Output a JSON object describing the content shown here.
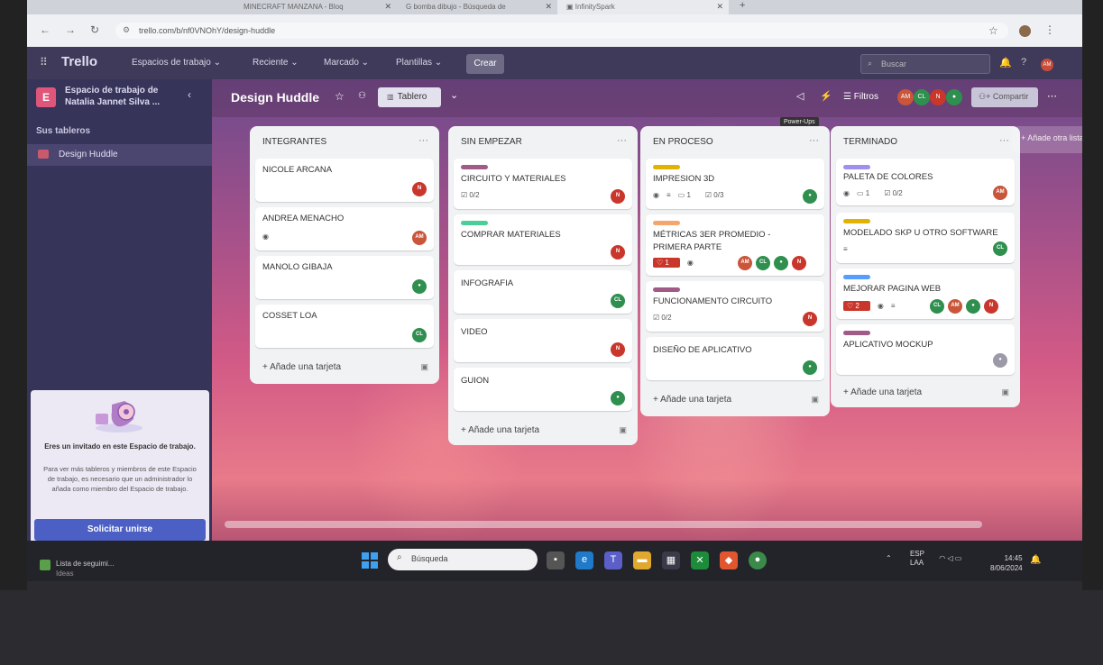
{
  "browser": {
    "tabs": [
      {
        "title": "MINECRAFT MANZANA - Bloq"
      },
      {
        "title": "bomba dibujo - Búsqueda de"
      },
      {
        "title": "InfinitySpark"
      }
    ],
    "url": "trello.com/b/nf0VNOhY/design-huddle"
  },
  "header": {
    "logo": "Trello",
    "nav": [
      "Espacios de trabajo",
      "Reciente",
      "Marcado",
      "Plantillas"
    ],
    "create": "Crear",
    "search_placeholder": "Buscar",
    "avatar": "AM"
  },
  "sidebar": {
    "workspace_initial": "E",
    "workspace_name": "Espacio de trabajo de Natalia Jannet Silva ...",
    "boards_heading": "Sus tableros",
    "boards": [
      "Design Huddle"
    ],
    "invite": {
      "title": "Eres un invitado en este Espacio de trabajo.",
      "body": "Para ver más tableros y miembros de este Espacio de trabajo, es necesario que un administrador lo añada como miembro del Espacio de trabajo.",
      "button": "Solicitar unirse"
    }
  },
  "board": {
    "title": "Design Huddle",
    "view": "Tablero",
    "filters": "Filtros",
    "powerups_tooltip": "Power-Ups",
    "members": [
      "AM",
      "CL",
      "N"
    ],
    "share": "Compartir",
    "add_list": "Añade otra lista",
    "add_card": "Añade una tarjeta",
    "lists": [
      {
        "name": "INTEGRANTES",
        "cards": [
          {
            "title": "NICOLE ARCANA",
            "members": [
              "N"
            ]
          },
          {
            "title": "ANDREA MENACHO",
            "members": [
              "AM"
            ]
          },
          {
            "title": "MANOLO GIBAJA",
            "members": [
              "person"
            ]
          },
          {
            "title": "COSSET LOA",
            "members": [
              "CL"
            ]
          }
        ]
      },
      {
        "name": "SIN EMPEZAR",
        "cards": [
          {
            "title": "CIRCUITO Y MATERIALES",
            "checklist": "0/2",
            "members": [
              "N"
            ]
          },
          {
            "title": "COMPRAR MATERIALES",
            "members": [
              "N"
            ]
          },
          {
            "title": "INFOGRAFIA",
            "members": [
              "CL"
            ]
          },
          {
            "title": "VIDEO",
            "members": [
              "N"
            ]
          },
          {
            "title": "GUION",
            "members": [
              "person"
            ]
          }
        ]
      },
      {
        "name": "EN PROCESO",
        "cards": [
          {
            "title": "IMPRESION 3D",
            "comments": "1",
            "checklist": "0/3",
            "members": [
              "person"
            ]
          },
          {
            "title": "MÉTRICAS 3ER PROMEDIO - PRIMERA PARTE",
            "votes": "1",
            "members": [
              "AM",
              "CL",
              "person",
              "N"
            ]
          },
          {
            "title": "FUNCIONAMENTO CIRCUITO",
            "checklist": "0/2",
            "members": [
              "N"
            ]
          },
          {
            "title": "DISEÑO DE APLICATIVO",
            "members": [
              "person"
            ]
          }
        ]
      },
      {
        "name": "TERMINADO",
        "cards": [
          {
            "title": "PALETA DE COLORES",
            "comments": "1",
            "checklist": "0/2",
            "members": [
              "AM"
            ]
          },
          {
            "title": "MODELADO SKP U OTRO SOFTWARE",
            "members": [
              "CL"
            ]
          },
          {
            "title": "MEJORAR PAGINA WEB",
            "votes": "2",
            "members": [
              "CL",
              "AM",
              "person",
              "N"
            ]
          },
          {
            "title": "APLICATIVO MOCKUP",
            "members": [
              "person"
            ]
          }
        ]
      }
    ]
  },
  "taskbar": {
    "news_title": "Lista de seguimi...",
    "news_sub": "Ideas",
    "search": "Búsqueda",
    "lang": "ESP",
    "lang_sub": "LAA",
    "time": "14:45",
    "date": "8/06/2024"
  },
  "colors": {
    "n": "#c9372c",
    "am": "#c9553a",
    "cl": "#2f8f4e",
    "person": "#2f8f4e",
    "label_purple": "#a05b87",
    "label_green": "#4bce97",
    "label_yellow": "#e2b203",
    "label_orange": "#f5a66b",
    "label_blue": "#579dff",
    "label_violet": "#9f8fef"
  }
}
